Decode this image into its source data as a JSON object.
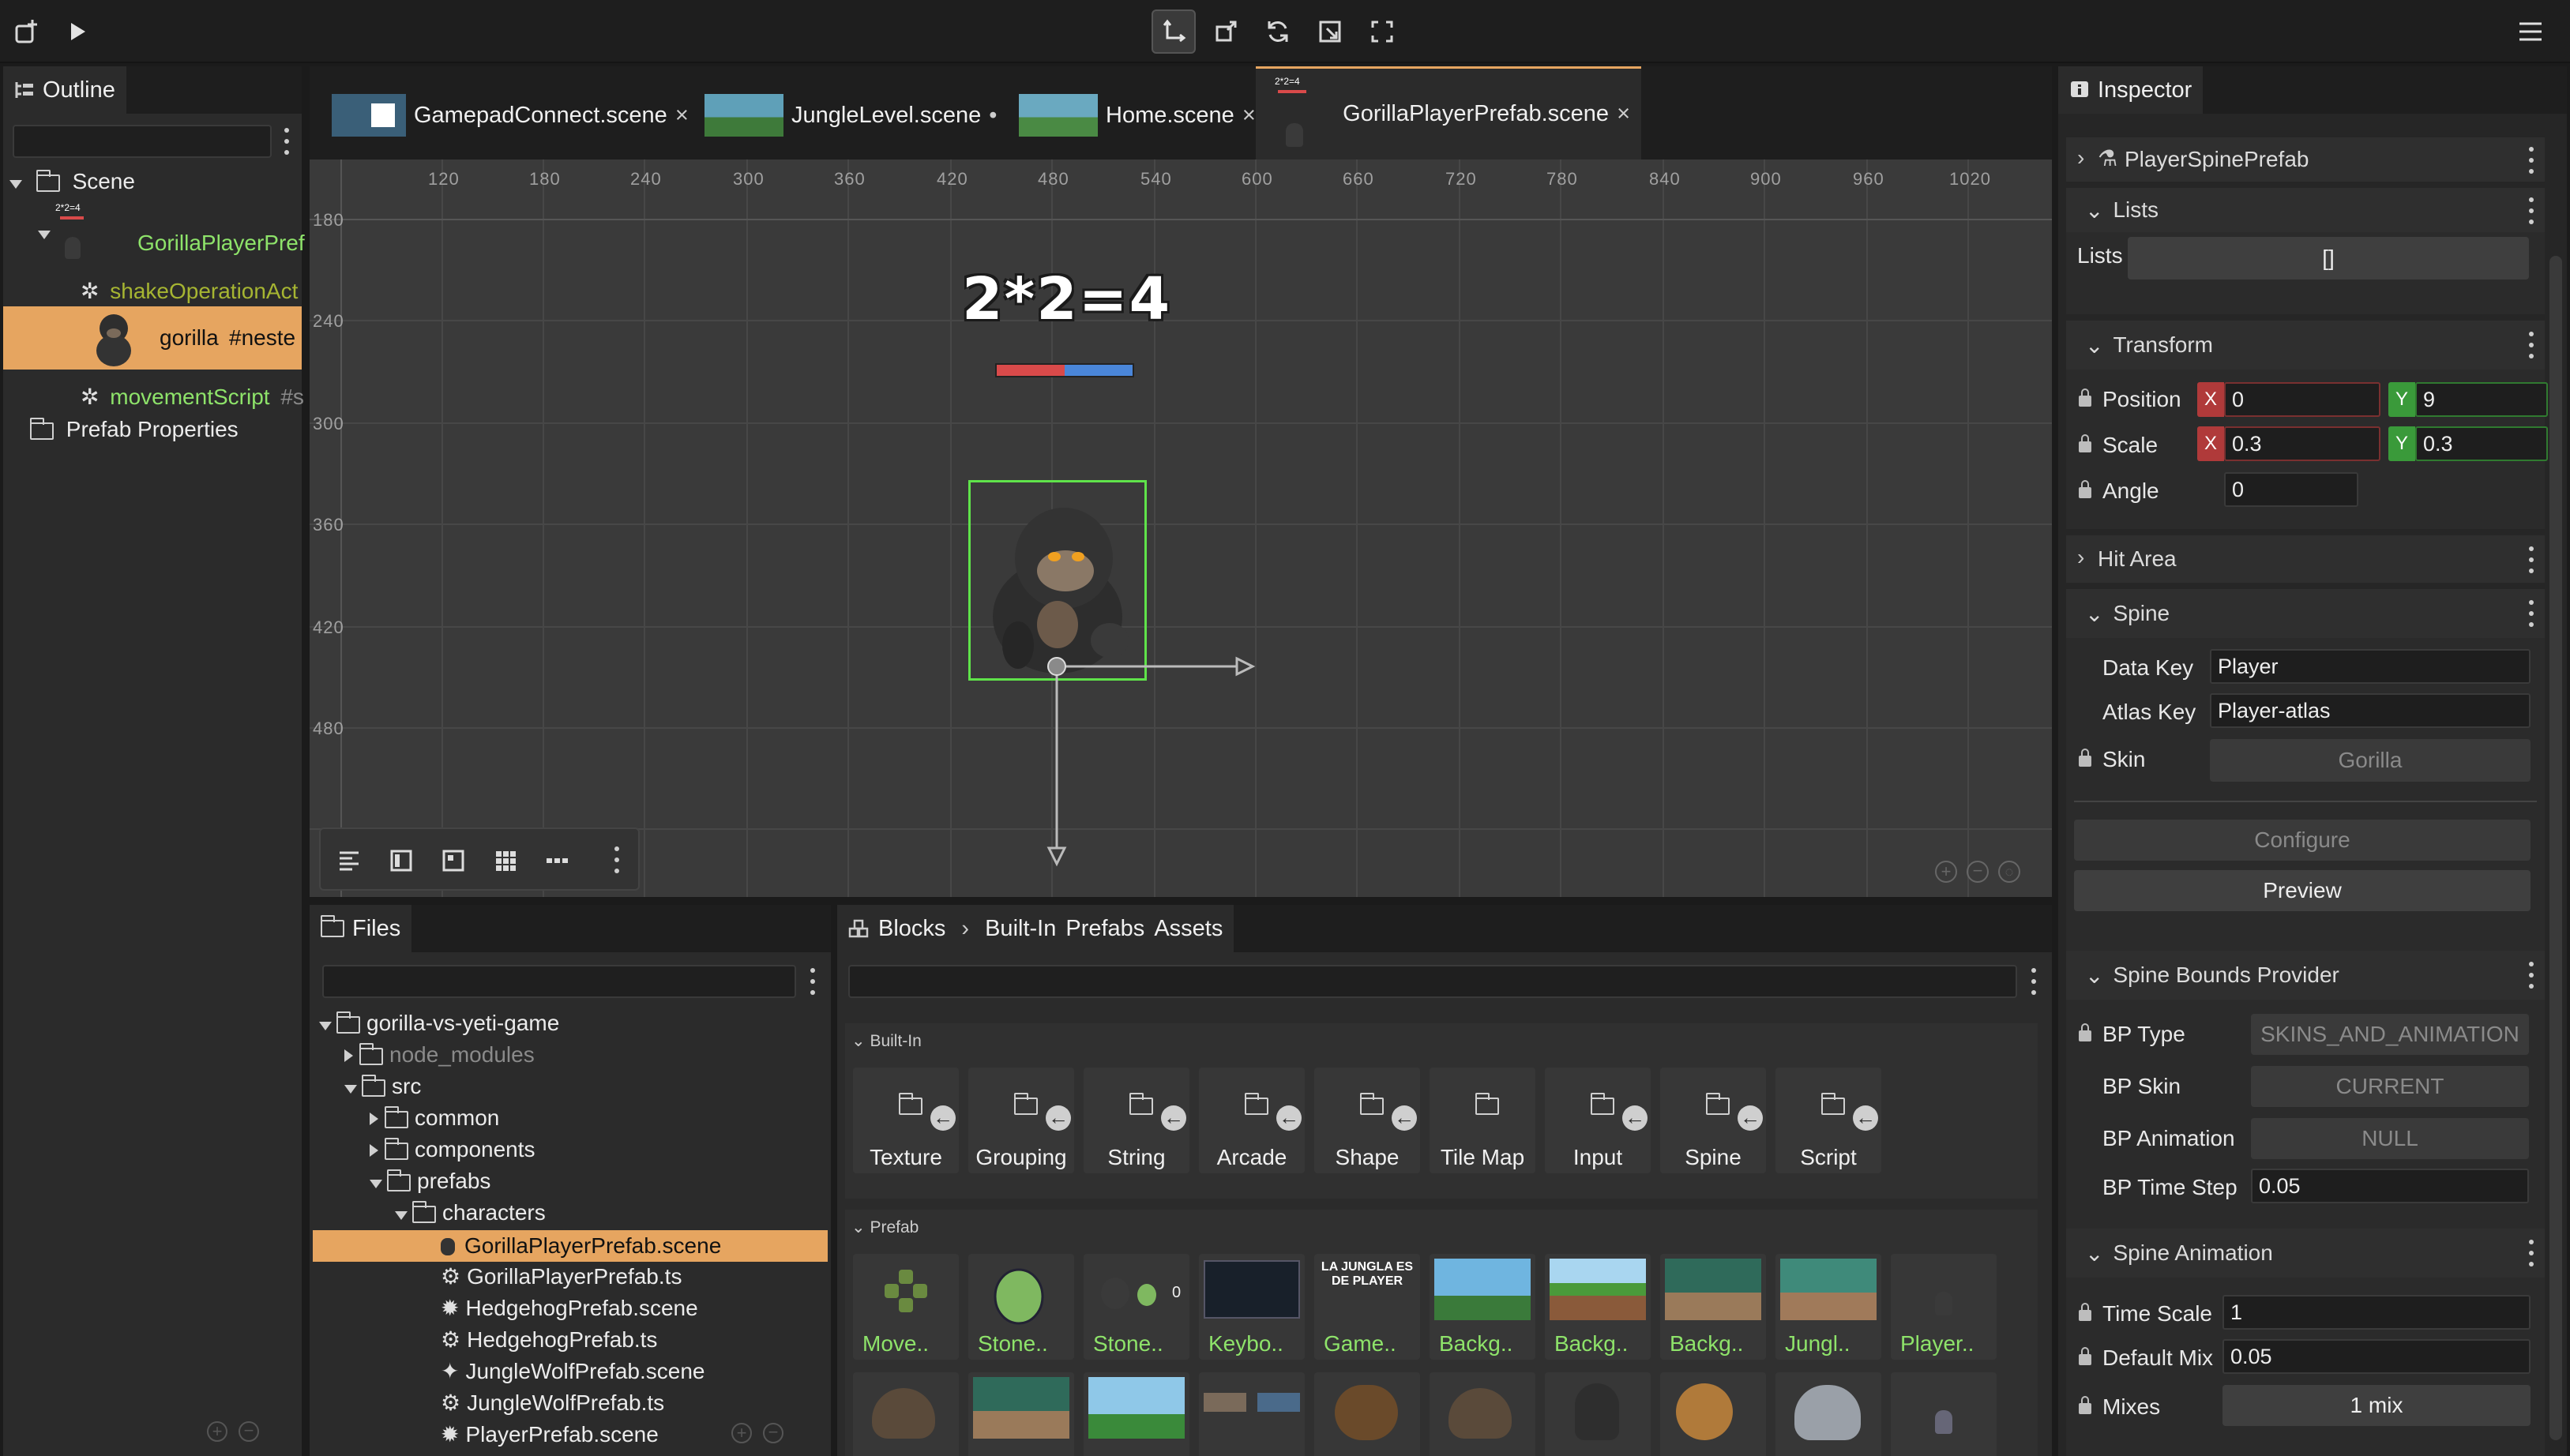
{
  "toolbar": {
    "left_icons": [
      "add-scene-icon",
      "play-icon"
    ],
    "center_icons": [
      "translate-tool-icon",
      "resize-tool-icon",
      "rotate-tool-icon",
      "scale-tool-icon",
      "fullscreen-icon"
    ],
    "menu_icon": "hamburger-menu-icon"
  },
  "outline": {
    "title": "Outline",
    "items": [
      {
        "label": "Scene"
      },
      {
        "label": "GorillaPlayerPref",
        "badge": "2*2=4"
      },
      {
        "label": "shakeOperationAct"
      },
      {
        "label": "gorilla",
        "suffix": "#neste"
      },
      {
        "label": "movementScript",
        "suffix": "#s"
      },
      {
        "label": "Prefab Properties"
      }
    ]
  },
  "editor_tabs": [
    {
      "label": "GamepadConnect.scene",
      "close": "×"
    },
    {
      "label": "JungleLevel.scene",
      "close": "•"
    },
    {
      "label": "Home.scene",
      "close": "×"
    },
    {
      "label": "GorillaPlayerPrefab.scene",
      "close": "×",
      "badge": "2*2=4"
    }
  ],
  "viewport": {
    "ruler_x": [
      "120",
      "180",
      "240",
      "300",
      "360",
      "420",
      "480",
      "540",
      "600",
      "660",
      "720",
      "780",
      "840",
      "900",
      "960",
      "1020"
    ],
    "ruler_y": [
      "180",
      "240",
      "300",
      "360",
      "420",
      "480"
    ],
    "scene_text": "2*2=4",
    "health_bar": {
      "red_fraction": 0.5,
      "red": "#d94a4a",
      "blue": "#4a86d9"
    },
    "selection_color": "#5fe34a",
    "bottom_tools": [
      "align-left-icon",
      "panel-icon",
      "frame-icon",
      "grid-icon",
      "dots-icon",
      "more-icon"
    ]
  },
  "files": {
    "title": "Files",
    "tree": [
      {
        "label": "gorilla-vs-yeti-game"
      },
      {
        "label": "node_modules"
      },
      {
        "label": "src"
      },
      {
        "label": "common"
      },
      {
        "label": "components"
      },
      {
        "label": "prefabs"
      },
      {
        "label": "characters"
      },
      {
        "label": "GorillaPlayerPrefab.scene"
      },
      {
        "label": "GorillaPlayerPrefab.ts"
      },
      {
        "label": "HedgehogPrefab.scene"
      },
      {
        "label": "HedgehogPrefab.ts"
      },
      {
        "label": "JungleWolfPrefab.scene"
      },
      {
        "label": "JungleWolfPrefab.ts"
      },
      {
        "label": "PlayerPrefab.scene"
      }
    ]
  },
  "blocks": {
    "title": "Blocks",
    "crumbs": [
      "Built-In",
      "Prefabs",
      "Assets"
    ],
    "builtin_title": "Built-In",
    "builtin": [
      "Texture",
      "Grouping",
      "String",
      "Arcade",
      "Shape",
      "Tile Map",
      "Input",
      "Spine",
      "Script"
    ],
    "prefab_title": "Prefab",
    "prefabs": [
      "Move..",
      "Stone..",
      "Stone..",
      "Keybo..",
      "Game..",
      "Backg..",
      "Backg..",
      "Backg..",
      "Jungl..",
      "Player.."
    ],
    "stone_count": "0",
    "game_text": "LA JUNGLA ES DE PLAYER"
  },
  "inspector": {
    "title": "Inspector",
    "prefab_name": "PlayerSpinePrefab",
    "lists": {
      "title": "Lists",
      "label": "Lists",
      "value": "[]"
    },
    "transform": {
      "title": "Transform",
      "position_label": "Position",
      "pos_x": "0",
      "pos_y": "9",
      "scale_label": "Scale",
      "scale_x": "0.3",
      "scale_y": "0.3",
      "angle_label": "Angle",
      "angle": "0",
      "x": "X",
      "y": "Y"
    },
    "hit_area": "Hit Area",
    "spine": {
      "title": "Spine",
      "data_key_label": "Data Key",
      "data_key": "Player",
      "atlas_key_label": "Atlas Key",
      "atlas_key": "Player-atlas",
      "skin_label": "Skin",
      "skin": "Gorilla",
      "configure": "Configure",
      "preview": "Preview"
    },
    "bounds": {
      "title": "Spine Bounds Provider",
      "bp_type_label": "BP Type",
      "bp_type": "SKINS_AND_ANIMATION",
      "bp_skin_label": "BP Skin",
      "bp_skin": "CURRENT",
      "bp_anim_label": "BP Animation",
      "bp_anim": "NULL",
      "bp_step_label": "BP Time Step",
      "bp_step": "0.05"
    },
    "animation": {
      "title": "Spine Animation",
      "time_scale_label": "Time Scale",
      "time_scale": "1",
      "default_mix_label": "Default Mix",
      "default_mix": "0.05",
      "mixes_label": "Mixes",
      "mixes": "1 mix"
    },
    "colors": {
      "x_axis": "#b03a3a",
      "y_axis": "#3a9a3a"
    }
  }
}
